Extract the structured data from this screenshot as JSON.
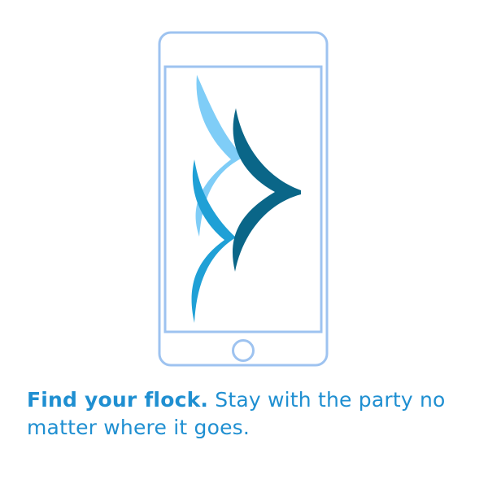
{
  "colors": {
    "phone_outline": "#9ec3f0",
    "wing_light": "#7fcdf7",
    "wing_mid": "#1fa0d6",
    "wing_dark": "#0a6688",
    "text": "#1f8fd1"
  },
  "icons": {
    "phone": "smartphone-outline-icon",
    "logo": "flock-wings-logo-icon"
  },
  "tagline": {
    "headline": "Find your flock.",
    "body": " Stay with the party no matter where it goes."
  }
}
